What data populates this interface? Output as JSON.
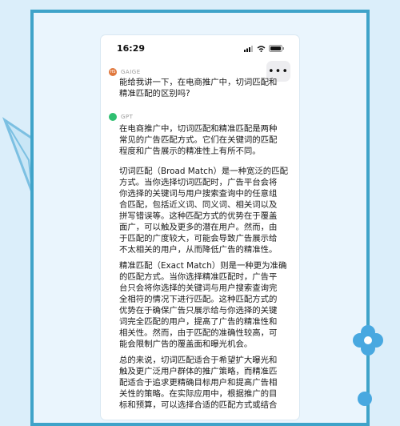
{
  "status_bar": {
    "time": "16:29"
  },
  "menu": {
    "more_label": "•••"
  },
  "chat": {
    "user": {
      "name": "GAIGE",
      "initials": "HS",
      "lines": [
        "能给我讲一下，在电商推广中，切词匹配和",
        "精准匹配的区别吗?"
      ]
    },
    "assistant": {
      "name": "GPT",
      "paragraphs": [
        [
          "在电商推广中，切词匹配和精准匹配是两种",
          "常见的广告匹配方式。它们在关键词的匹配",
          "程度和广告展示的精准性上有所不同。"
        ],
        [
          "切词匹配（Broad Match）是一种宽泛的匹配",
          "方式。当你选择切词匹配时，广告平台会将",
          "你选择的关键词与用户搜索查询中的任意组",
          "合匹配，包括近义词、同义词、相关词以及",
          "拼写错误等。这种匹配方式的优势在于覆盖",
          "面广，可以触及更多的潜在用户。然而，由",
          "于匹配的广度较大，可能会导致广告展示给",
          "不太相关的用户，从而降低广告的精准性。"
        ],
        [
          "精准匹配（Exact Match）则是一种更为准确",
          "的匹配方式。当你选择精准匹配时，广告平",
          "台只会将你选择的关键词与用户搜索查询完",
          "全相符的情况下进行匹配。这种匹配方式的",
          "优势在于确保广告只展示给与你选择的关键",
          "词完全匹配的用户，提高了广告的精准性和",
          "相关性。然而，由于匹配的准确性较高，可",
          "能会限制广告的覆盖面和曝光机会。"
        ],
        [
          "总的来说，切词匹配适合于希望扩大曝光和",
          "触及更广泛用户群体的推广策略，而精准匹",
          "配适合于追求更精确目标用户和提高广告相",
          "关性的策略。在实际应用中，根据推广的目",
          "标和预算，可以选择合适的匹配方式或结合"
        ]
      ]
    }
  },
  "colors": {
    "frame": "#3fa3c9",
    "background": "#dbeefa",
    "gpt_avatar": "#2fbf71",
    "user_avatar": "#e0773c"
  }
}
